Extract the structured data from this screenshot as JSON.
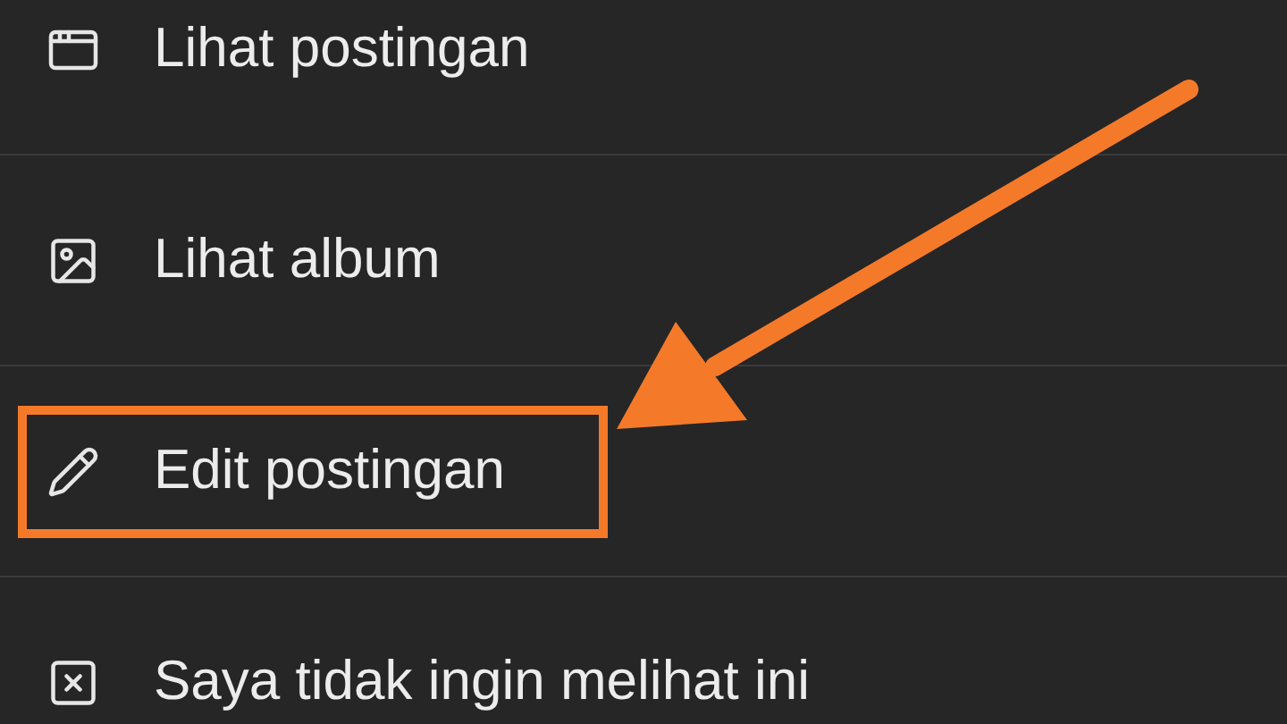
{
  "menu": {
    "items": [
      {
        "label": "Lihat postingan",
        "highlighted": false
      },
      {
        "label": "Lihat album",
        "highlighted": false
      },
      {
        "label": "Edit postingan",
        "highlighted": true
      },
      {
        "label": "Saya tidak ingin melihat ini",
        "highlighted": false
      }
    ]
  }
}
